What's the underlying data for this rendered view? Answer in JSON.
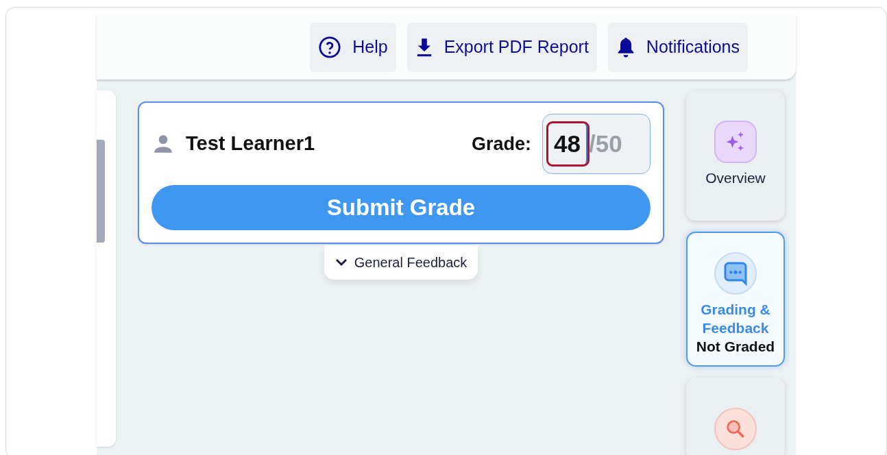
{
  "header_buttons": [
    {
      "kind": "help",
      "label": "Help"
    },
    {
      "kind": "export",
      "label": "Export PDF Report"
    },
    {
      "kind": "notifications",
      "label": "Notifications"
    }
  ],
  "grade_card": {
    "learner": "Test Learner1",
    "grade_label": "Grade:",
    "grade_value": "48",
    "grade_max": "/50",
    "grade_highlighted": true,
    "submit_label": "Submit Grade"
  },
  "feedback_toggle": {
    "label": "General Feedback",
    "expanded": false
  },
  "side_tabs": [
    {
      "kind": "overview",
      "label": "Overview",
      "selected": false
    },
    {
      "kind": "grading",
      "label": "Grading & Feedback",
      "status": "Not Graded",
      "selected": true
    },
    {
      "kind": "search",
      "selected": false
    }
  ]
}
